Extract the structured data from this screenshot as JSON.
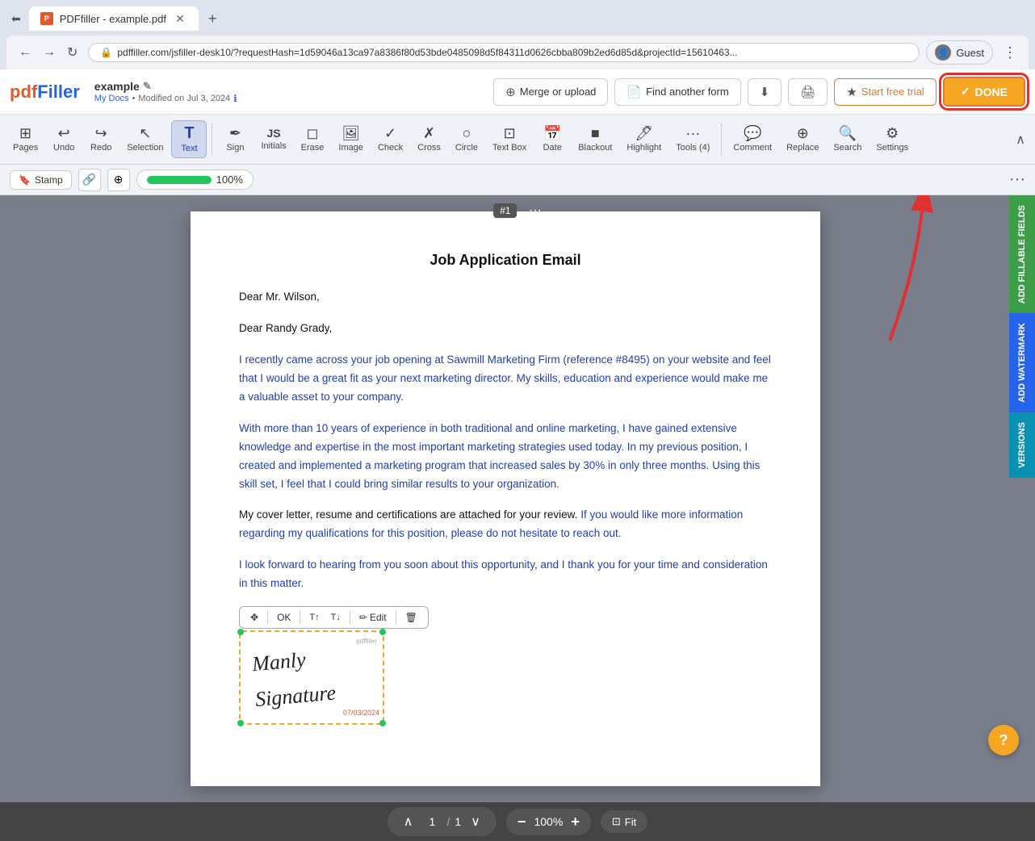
{
  "browser": {
    "tab_title": "PDFfiller - example.pdf",
    "url": "pdffiller.com/jsfiller-desk10/?requestHash=1d59046a13ca97a8386f80d53bde0485098d5f84311d0626cbba809b2ed6d85d&projectId=15610463...",
    "profile_label": "Guest"
  },
  "header": {
    "logo_pdf": "pdf",
    "logo_filler": "Filler",
    "doc_title": "example",
    "edit_icon": "✎",
    "my_docs": "My Docs",
    "modified": "Modified on Jul 3, 2024",
    "merge_upload_label": "Merge or upload",
    "find_form_label": "Find another form",
    "start_free_label": "Start free trial",
    "done_label": "DONE"
  },
  "toolbar": {
    "items": [
      {
        "id": "pages",
        "label": "Pages",
        "icon": "⊞"
      },
      {
        "id": "undo",
        "label": "Undo",
        "icon": "↩"
      },
      {
        "id": "redo",
        "label": "Redo",
        "icon": "↪"
      },
      {
        "id": "selection",
        "label": "Selection",
        "icon": "↖"
      },
      {
        "id": "text",
        "label": "Text",
        "icon": "T",
        "active": true
      },
      {
        "id": "sign",
        "label": "Sign",
        "icon": "✒"
      },
      {
        "id": "initials",
        "label": "Initials",
        "icon": "JS"
      },
      {
        "id": "erase",
        "label": "Erase",
        "icon": "◻"
      },
      {
        "id": "image",
        "label": "Image",
        "icon": "🖼"
      },
      {
        "id": "check",
        "label": "Check",
        "icon": "✓"
      },
      {
        "id": "cross",
        "label": "Cross",
        "icon": "✗"
      },
      {
        "id": "circle",
        "label": "Circle",
        "icon": "○"
      },
      {
        "id": "textbox",
        "label": "Text Box",
        "icon": "⊡"
      },
      {
        "id": "date",
        "label": "Date",
        "icon": "📅"
      },
      {
        "id": "blackout",
        "label": "Blackout",
        "icon": "■"
      },
      {
        "id": "highlight",
        "label": "Highlight",
        "icon": "🖊"
      },
      {
        "id": "tools",
        "label": "Tools (4)",
        "icon": "···"
      },
      {
        "id": "comment",
        "label": "Comment",
        "icon": "💬"
      },
      {
        "id": "replace",
        "label": "Replace",
        "icon": "⊕"
      },
      {
        "id": "search",
        "label": "Search",
        "icon": "🔍"
      },
      {
        "id": "settings",
        "label": "Settings",
        "icon": "⚙"
      }
    ]
  },
  "subtoolbar": {
    "stamp_label": "Stamp",
    "progress_value": 100,
    "progress_label": "100%"
  },
  "pdf": {
    "page_number": "#1",
    "title": "Job Application Email",
    "paragraphs": [
      {
        "id": "salutation",
        "text": "Dear Mr. Wilson,"
      },
      {
        "id": "greeting",
        "text": "Dear Randy Grady,"
      },
      {
        "id": "p1",
        "text": "I recently came across your job opening at Sawmill Marketing Firm (reference #8495) on your website and feel that I would be a great fit as your next marketing director. My skills, education and experience would make me a valuable asset to your company."
      },
      {
        "id": "p2",
        "text": "With more than 10 years of experience in both traditional and online marketing, I have gained extensive knowledge and expertise in the most important marketing strategies used today. In my previous position, I created and implemented a marketing program that increased sales by 30% in only three months. Using this skill set, I feel that I could bring similar results to your organization."
      },
      {
        "id": "p3",
        "text": "My cover letter, resume and certifications are attached for your review. If you would like more information regarding my qualifications for this position, please do not hesitate to reach out."
      },
      {
        "id": "p4",
        "text": "I look forward to hearing from you soon about this opportunity, and I thank you for your time and consideration in this matter."
      }
    ],
    "signature_text": "Manly Signature",
    "sig_date": "07/03/2024",
    "sig_watermark": "pdffiller"
  },
  "signature_toolbar": {
    "move_icon": "✥",
    "ok_label": "OK",
    "size_up_icon": "T↑",
    "size_down_icon": "T↓",
    "edit_icon": "✏",
    "edit_label": "Edit",
    "delete_icon": "🗑"
  },
  "bottom_bar": {
    "page_current": "1",
    "page_total": "1",
    "zoom_minus": "−",
    "zoom_value": "100%",
    "zoom_plus": "+",
    "fit_icon": "⊡",
    "fit_label": "Fit"
  },
  "right_panels": [
    {
      "id": "fillable",
      "label": "ADD FILLABLE FIELDS",
      "color": "green"
    },
    {
      "id": "watermark",
      "label": "ADD WATERMARK",
      "color": "blue2"
    },
    {
      "id": "versions",
      "label": "VERSIONS",
      "color": "teal"
    }
  ],
  "help": {
    "label": "?"
  }
}
